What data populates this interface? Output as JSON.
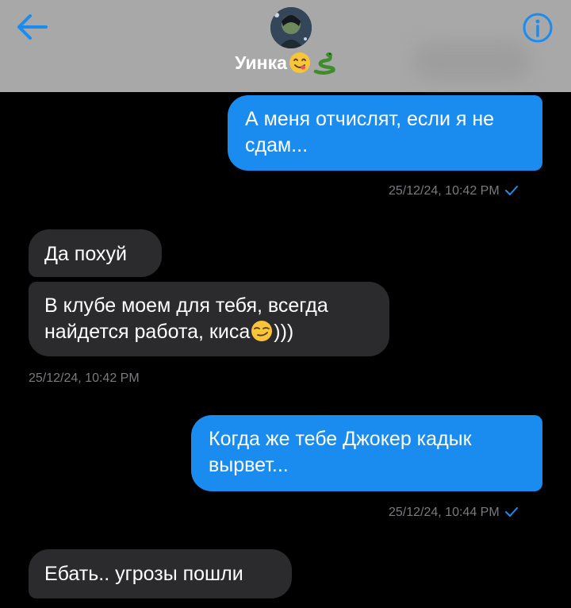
{
  "header": {
    "contact_name": "Уинка",
    "icons": {
      "back": "back-arrow-icon",
      "info": "info-icon",
      "name_emoji_1": "yum-face-emoji",
      "name_emoji_2": "snake-emoji"
    }
  },
  "colors": {
    "header_bg": "#a8a8a8",
    "accent": "#1a8cf0",
    "outgoing_bubble": "#1a8cf0",
    "incoming_bubble": "#2b2b2e",
    "background": "#000000",
    "meta_text": "#7a7a7f"
  },
  "messages": [
    {
      "direction": "out",
      "text": "А меня отчислят, если я не сдам..."
    },
    {
      "direction": "out",
      "timestamp": "25/12/24, 10:42 PM",
      "status": "sent-check-icon"
    },
    {
      "direction": "in",
      "text": "Да похуй"
    },
    {
      "direction": "in",
      "text": "В клубе моем для тебя, всегда найдется работа, киса",
      "suffix": ")))",
      "emoji": "smirk-face-emoji"
    },
    {
      "direction": "in",
      "timestamp": "25/12/24, 10:42 PM"
    },
    {
      "direction": "out",
      "text": "Когда же тебе Джокер кадык вырвет..."
    },
    {
      "direction": "out",
      "timestamp": "25/12/24, 10:44 PM",
      "status": "sent-check-icon"
    },
    {
      "direction": "in",
      "text": "Ебать.. угрозы пошли"
    }
  ]
}
